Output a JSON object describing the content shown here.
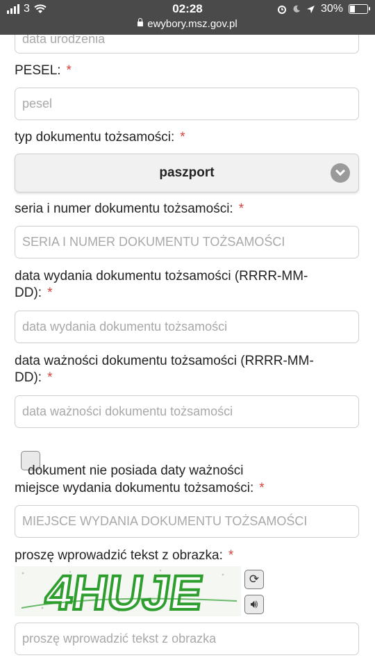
{
  "status_bar": {
    "carrier": "3",
    "time": "02:28",
    "battery": "30%",
    "url": "ewybory.msz.gov.pl"
  },
  "form": {
    "birthdate_placeholder": "data urodzenia",
    "pesel_label": "PESEL:",
    "pesel_placeholder": "pesel",
    "doc_type_label": "typ dokumentu tożsamości:",
    "doc_type_value": "paszport",
    "doc_number_label": "seria i numer dokumentu tożsamości:",
    "doc_number_placeholder": "SERIA I NUMER DOKUMENTU TOŻSAMOŚCI",
    "issue_date_label_line1": "data wydania dokumentu tożsamości (RRRR-MM-",
    "issue_date_label_line2": "DD):",
    "issue_date_placeholder": "data wydania dokumentu tożsamości",
    "expiry_date_label_line1": "data ważności dokumentu tożsamości (RRRR-MM-",
    "expiry_date_label_line2": "DD):",
    "expiry_date_placeholder": "data ważności dokumentu tożsamości",
    "no_expiry_label": "dokument nie posiada daty ważności",
    "issue_place_label": "miejsce wydania dokumentu tożsamości:",
    "issue_place_placeholder": "MIEJSCE WYDANIA DOKUMENTU TOŻSAMOŚCI",
    "captcha_label": "proszę wprowadzić tekst z obrazka:",
    "captcha_text": "4HUJE",
    "captcha_placeholder": "proszę wprowadzić tekst z obrazka",
    "required_mark": "*"
  }
}
